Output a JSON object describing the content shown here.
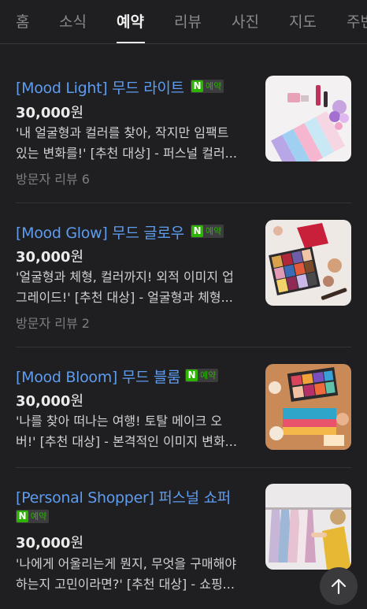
{
  "tabs": [
    {
      "label": "홈"
    },
    {
      "label": "소식"
    },
    {
      "label": "예약"
    },
    {
      "label": "리뷰"
    },
    {
      "label": "사진"
    },
    {
      "label": "지도"
    },
    {
      "label": "주변"
    }
  ],
  "active_tab": "예약",
  "badge_label": "예약",
  "items": [
    {
      "title": "[Mood Light] 무드 라이트",
      "price_value": "30,000",
      "price_unit": "원",
      "desc_line1": "'내 얼굴형과 컬러를 찾아, 작지만 임팩트",
      "desc_line2": "있는 변화를!' [추천 대상] - 퍼스널 컬러...",
      "review": "방문자 리뷰 6",
      "thumb_icon": "cosmetics-photo"
    },
    {
      "title": "[Mood Glow] 무드 글로우",
      "price_value": "30,000",
      "price_unit": "원",
      "desc_line1": "'얼굴형과 체형, 컬러까지! 외적 이미지 업",
      "desc_line2": "그레이드!' [추천 대상] - 얼굴형과 체형...",
      "review": "방문자 리뷰 2",
      "thumb_icon": "makeup-palette-photo"
    },
    {
      "title": "[Mood Bloom] 무드 블룸",
      "price_value": "30,000",
      "price_unit": "원",
      "desc_line1": "'나를 찾아 떠나는 여행! 토탈 메이크 오",
      "desc_line2": "버!' [추천 대상] - 본격적인 이미지 변화...",
      "thumb_icon": "makeup-swatches-photo"
    },
    {
      "title": "[Personal Shopper] 퍼스널 쇼퍼",
      "price_value": "30,000",
      "price_unit": "원",
      "desc_line1": "'나에게 어울리는게 뭔지, 무엇을 구매해야",
      "desc_line2": "하는지 고민이라면?' [추천 대상] - 쇼핑...",
      "thumb_icon": "clothing-rack-photo"
    }
  ],
  "colors": {
    "background": "#1f1f21",
    "title_link": "#5e9cf0",
    "naver_green": "#2db400"
  }
}
